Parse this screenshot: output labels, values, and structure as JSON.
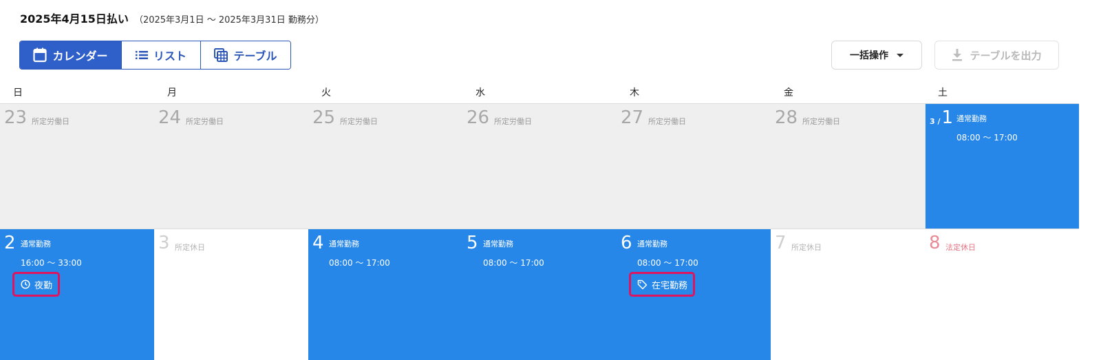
{
  "header": {
    "title": "2025年4月15日払い",
    "period": "（2025年3月1日 ～ 2025年3月31日 勤務分）"
  },
  "view_toggle": {
    "calendar": "カレンダー",
    "list": "リスト",
    "table": "テーブル"
  },
  "actions": {
    "bulk": "一括操作",
    "export": "テーブルを出力"
  },
  "weekdays": [
    "日",
    "月",
    "火",
    "水",
    "木",
    "金",
    "土"
  ],
  "weeks": [
    [
      {
        "day": "23",
        "status": "所定労働日"
      },
      {
        "day": "24",
        "status": "所定労働日"
      },
      {
        "day": "25",
        "status": "所定労働日"
      },
      {
        "day": "26",
        "status": "所定労働日"
      },
      {
        "day": "27",
        "status": "所定労働日"
      },
      {
        "day": "28",
        "status": "所定労働日"
      },
      {
        "day": "1",
        "month_prefix": "3 /",
        "status": "通常勤務",
        "time": "08:00 ～ 17:00"
      }
    ],
    [
      {
        "day": "2",
        "status": "通常勤務",
        "time": "16:00 ～ 33:00",
        "tag": "夜勤"
      },
      {
        "day": "3",
        "status": "所定休日"
      },
      {
        "day": "4",
        "status": "通常勤務",
        "time": "08:00 ～ 17:00"
      },
      {
        "day": "5",
        "status": "通常勤務",
        "time": "08:00 ～ 17:00"
      },
      {
        "day": "6",
        "status": "通常勤務",
        "time": "08:00 ～ 17:00",
        "tag": "在宅勤務"
      },
      {
        "day": "7",
        "status": "所定休日"
      },
      {
        "day": "8",
        "status": "法定休日"
      }
    ]
  ],
  "colors": {
    "primary": "#2f5fc9",
    "work_day": "#2787e8",
    "prev_month": "#efefef",
    "highlight": "#e0135f",
    "holiday": "#e67482"
  }
}
